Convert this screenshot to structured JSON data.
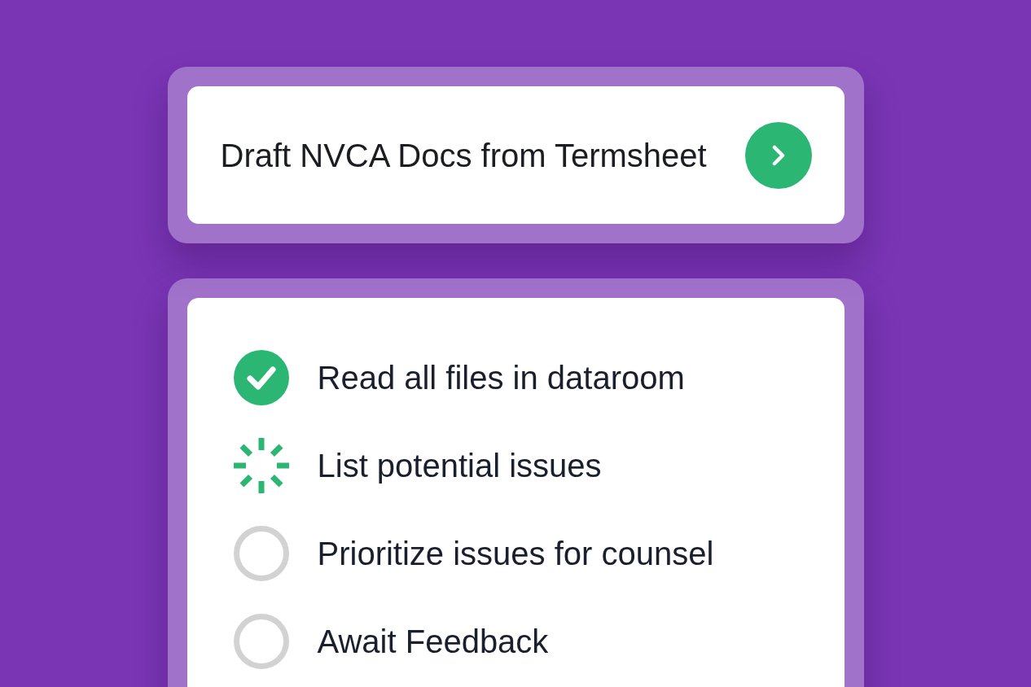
{
  "prompt_card": {
    "title": "Draft NVCA Docs from Termsheet"
  },
  "steps": [
    {
      "label": "Read all files in dataroom",
      "kind": "done"
    },
    {
      "label": "List potential issues",
      "kind": "running"
    },
    {
      "label": "Prioritize issues for counsel",
      "kind": "pending"
    },
    {
      "label": "Await Feedback",
      "kind": "pending"
    }
  ]
}
